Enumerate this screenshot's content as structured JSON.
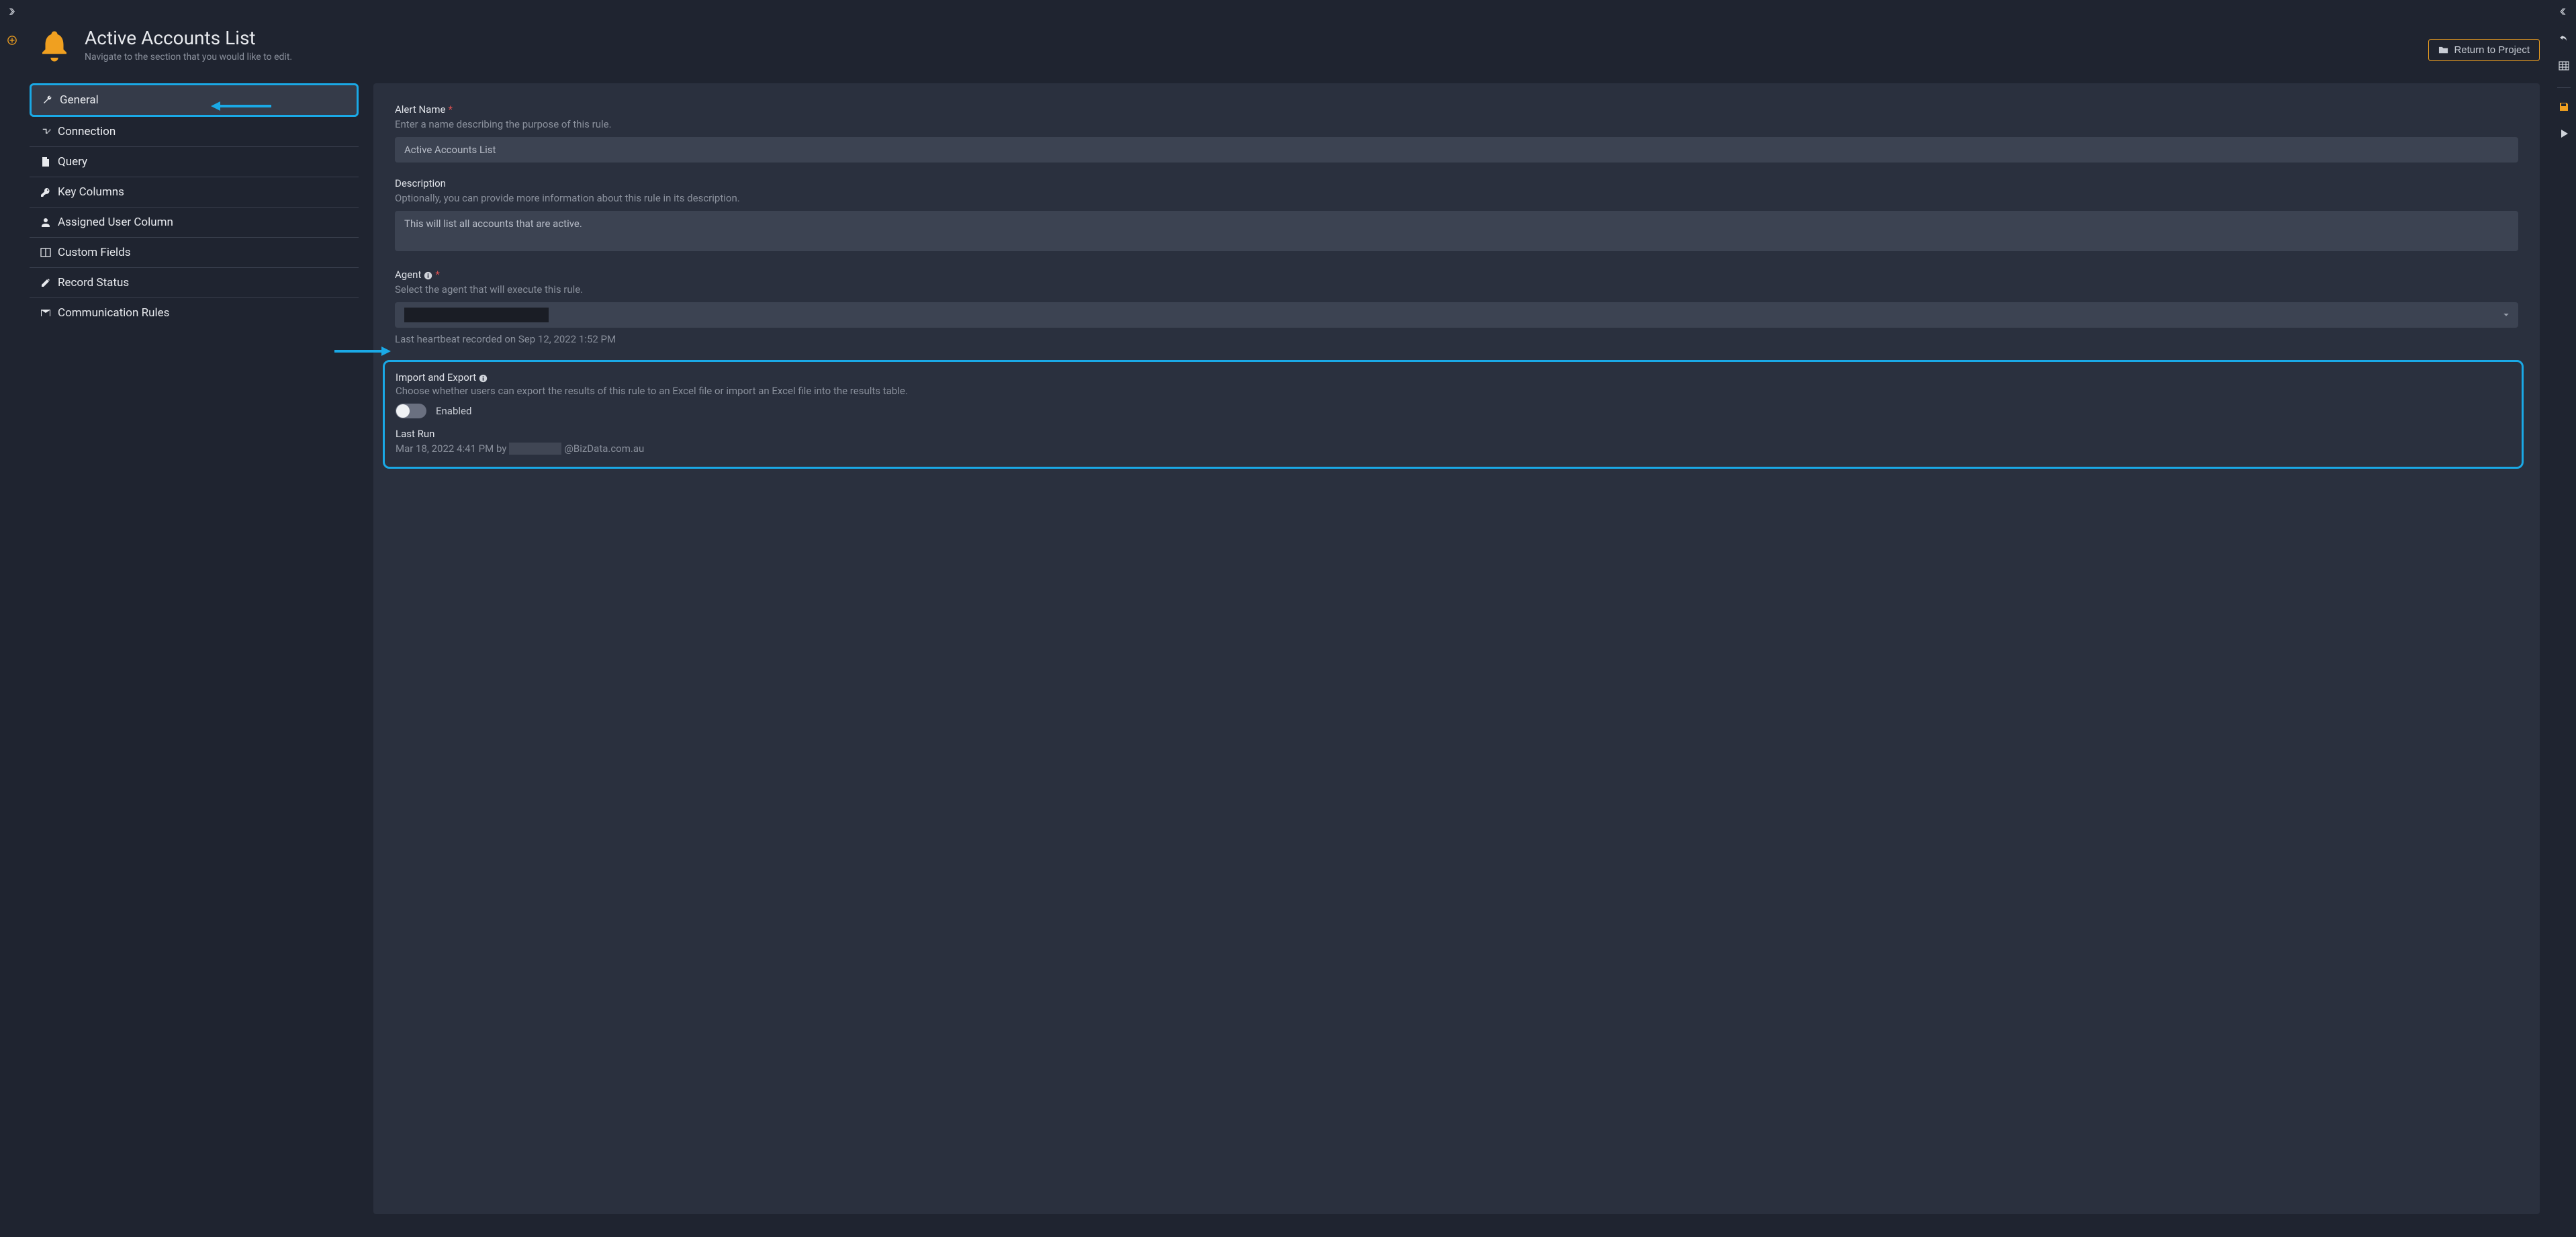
{
  "header": {
    "title": "Active Accounts List",
    "subtitle": "Navigate to the section that you would like to edit.",
    "return_label": "Return to Project"
  },
  "sidebar": {
    "items": [
      {
        "label": "General",
        "icon": "wrench"
      },
      {
        "label": "Connection",
        "icon": "plug"
      },
      {
        "label": "Query",
        "icon": "file"
      },
      {
        "label": "Key Columns",
        "icon": "key"
      },
      {
        "label": "Assigned User Column",
        "icon": "user"
      },
      {
        "label": "Custom Fields",
        "icon": "columns"
      },
      {
        "label": "Record Status",
        "icon": "edit"
      },
      {
        "label": "Communication Rules",
        "icon": "envelope"
      }
    ]
  },
  "form": {
    "alert_name": {
      "label": "Alert Name",
      "help": "Enter a name describing the purpose of this rule.",
      "value": "Active Accounts List"
    },
    "description": {
      "label": "Description",
      "help": "Optionally, you can provide more information about this rule in its description.",
      "value": "This will list all accounts that are active."
    },
    "agent": {
      "label": "Agent",
      "help": "Select the agent that will execute this rule.",
      "heartbeat": "Last heartbeat recorded on Sep 12, 2022 1:52 PM"
    },
    "import_export": {
      "label": "Import and Export",
      "help": "Choose whether users can export the results of this rule to an Excel file or import an Excel file into the results table.",
      "toggle_label": "Enabled"
    },
    "last_run": {
      "label": "Last Run",
      "prefix": "Mar 18, 2022 4:41 PM by ",
      "suffix": "@BizData.com.au"
    }
  },
  "colors": {
    "accent": "#f0a020",
    "highlight": "#1aa9e6"
  }
}
